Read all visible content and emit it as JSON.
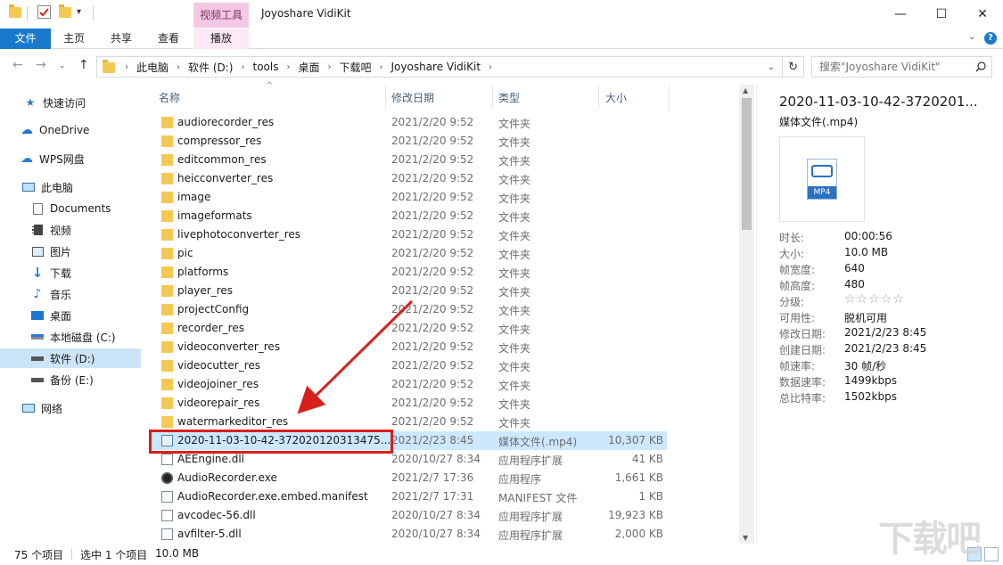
{
  "window": {
    "title": "Joyoshare VidiKit",
    "context_tab_group": "视频工具",
    "controls": {
      "minimize": "—",
      "maximize": "☐",
      "close": "✕"
    }
  },
  "ribbon": {
    "tabs": [
      "文件",
      "主页",
      "共享",
      "查看",
      "播放"
    ],
    "selected_tab": "文件"
  },
  "address": {
    "breadcrumbs": [
      "此电脑",
      "软件 (D:)",
      "tools",
      "桌面",
      "下载吧",
      "Joyoshare VidiKit"
    ],
    "search_placeholder": "搜索\"Joyoshare VidiKit\""
  },
  "nav": {
    "items": [
      {
        "label": "快速访问",
        "icon": "star-icon"
      },
      {
        "label": "OneDrive",
        "icon": "cloud-icon"
      },
      {
        "label": "WPS网盘",
        "icon": "cloud-icon"
      },
      {
        "label": "此电脑",
        "icon": "computer-icon"
      },
      {
        "label": "Documents",
        "icon": "document-icon"
      },
      {
        "label": "视频",
        "icon": "video-icon"
      },
      {
        "label": "图片",
        "icon": "picture-icon"
      },
      {
        "label": "下载",
        "icon": "download-icon"
      },
      {
        "label": "音乐",
        "icon": "music-icon"
      },
      {
        "label": "桌面",
        "icon": "desktop-icon"
      },
      {
        "label": "本地磁盘 (C:)",
        "icon": "drive-icon"
      },
      {
        "label": "软件 (D:)",
        "icon": "drive-icon"
      },
      {
        "label": "备份 (E:)",
        "icon": "drive-icon"
      },
      {
        "label": "网络",
        "icon": "network-icon"
      }
    ],
    "selected": "软件 (D:)"
  },
  "files": {
    "columns": [
      "名称",
      "修改日期",
      "类型",
      "大小"
    ],
    "rows": [
      {
        "name": "audiorecorder_res",
        "date": "2021/2/20 9:52",
        "type": "文件夹",
        "size": "",
        "icon": "folder"
      },
      {
        "name": "compressor_res",
        "date": "2021/2/20 9:52",
        "type": "文件夹",
        "size": "",
        "icon": "folder"
      },
      {
        "name": "editcommon_res",
        "date": "2021/2/20 9:52",
        "type": "文件夹",
        "size": "",
        "icon": "folder"
      },
      {
        "name": "heicconverter_res",
        "date": "2021/2/20 9:52",
        "type": "文件夹",
        "size": "",
        "icon": "folder"
      },
      {
        "name": "image",
        "date": "2021/2/20 9:52",
        "type": "文件夹",
        "size": "",
        "icon": "folder"
      },
      {
        "name": "imageformats",
        "date": "2021/2/20 9:52",
        "type": "文件夹",
        "size": "",
        "icon": "folder"
      },
      {
        "name": "livephotoconverter_res",
        "date": "2021/2/20 9:52",
        "type": "文件夹",
        "size": "",
        "icon": "folder"
      },
      {
        "name": "pic",
        "date": "2021/2/20 9:52",
        "type": "文件夹",
        "size": "",
        "icon": "folder"
      },
      {
        "name": "platforms",
        "date": "2021/2/20 9:52",
        "type": "文件夹",
        "size": "",
        "icon": "folder"
      },
      {
        "name": "player_res",
        "date": "2021/2/20 9:52",
        "type": "文件夹",
        "size": "",
        "icon": "folder"
      },
      {
        "name": "projectConfig",
        "date": "2021/2/20 9:52",
        "type": "文件夹",
        "size": "",
        "icon": "folder"
      },
      {
        "name": "recorder_res",
        "date": "2021/2/20 9:52",
        "type": "文件夹",
        "size": "",
        "icon": "folder"
      },
      {
        "name": "videoconverter_res",
        "date": "2021/2/20 9:52",
        "type": "文件夹",
        "size": "",
        "icon": "folder"
      },
      {
        "name": "videocutter_res",
        "date": "2021/2/20 9:52",
        "type": "文件夹",
        "size": "",
        "icon": "folder"
      },
      {
        "name": "videojoiner_res",
        "date": "2021/2/20 9:52",
        "type": "文件夹",
        "size": "",
        "icon": "folder"
      },
      {
        "name": "videorepair_res",
        "date": "2021/2/20 9:52",
        "type": "文件夹",
        "size": "",
        "icon": "folder"
      },
      {
        "name": "watermarkeditor_res",
        "date": "2021/2/20 9:52",
        "type": "文件夹",
        "size": "",
        "icon": "folder"
      },
      {
        "name": "2020-11-03-10-42-372020120313475...",
        "date": "2021/2/23 8:45",
        "type": "媒体文件(.mp4)",
        "size": "10,307 KB",
        "icon": "mp4"
      },
      {
        "name": "AEEngine.dll",
        "date": "2020/10/27 8:34",
        "type": "应用程序扩展",
        "size": "41 KB",
        "icon": "doc"
      },
      {
        "name": "AudioRecorder.exe",
        "date": "2021/2/7 17:36",
        "type": "应用程序",
        "size": "1,661 KB",
        "icon": "exe"
      },
      {
        "name": "AudioRecorder.exe.embed.manifest",
        "date": "2021/2/7 17:31",
        "type": "MANIFEST 文件",
        "size": "1 KB",
        "icon": "doc"
      },
      {
        "name": "avcodec-56.dll",
        "date": "2020/10/27 8:34",
        "type": "应用程序扩展",
        "size": "19,923 KB",
        "icon": "doc"
      },
      {
        "name": "avfilter-5.dll",
        "date": "2020/10/27 8:34",
        "type": "应用程序扩展",
        "size": "2,000 KB",
        "icon": "doc"
      }
    ],
    "selected_index": 17
  },
  "details": {
    "name": "2020-11-03-10-42-3720201...",
    "kind": "媒体文件(.mp4)",
    "thumb_label": "MP4",
    "props": [
      {
        "k": "时长:",
        "v": "00:00:56"
      },
      {
        "k": "大小:",
        "v": "10.0 MB"
      },
      {
        "k": "帧宽度:",
        "v": "640"
      },
      {
        "k": "帧高度:",
        "v": "480"
      },
      {
        "k": "分级:",
        "v": "☆☆☆☆☆"
      },
      {
        "k": "可用性:",
        "v": "脱机可用"
      },
      {
        "k": "修改日期:",
        "v": "2021/2/23 8:45"
      },
      {
        "k": "创建日期:",
        "v": "2021/2/23 8:45"
      },
      {
        "k": "帧速率:",
        "v": "30 帧/秒"
      },
      {
        "k": "数据速率:",
        "v": "1499kbps"
      },
      {
        "k": "总比特率:",
        "v": "1502kbps"
      }
    ]
  },
  "status": {
    "count": "75 个项目",
    "selection": "选中 1 个项目",
    "size": "10.0 MB"
  },
  "colors": {
    "accent": "#1979ca",
    "selection": "#cce8ff",
    "annotation": "#d8201a"
  }
}
